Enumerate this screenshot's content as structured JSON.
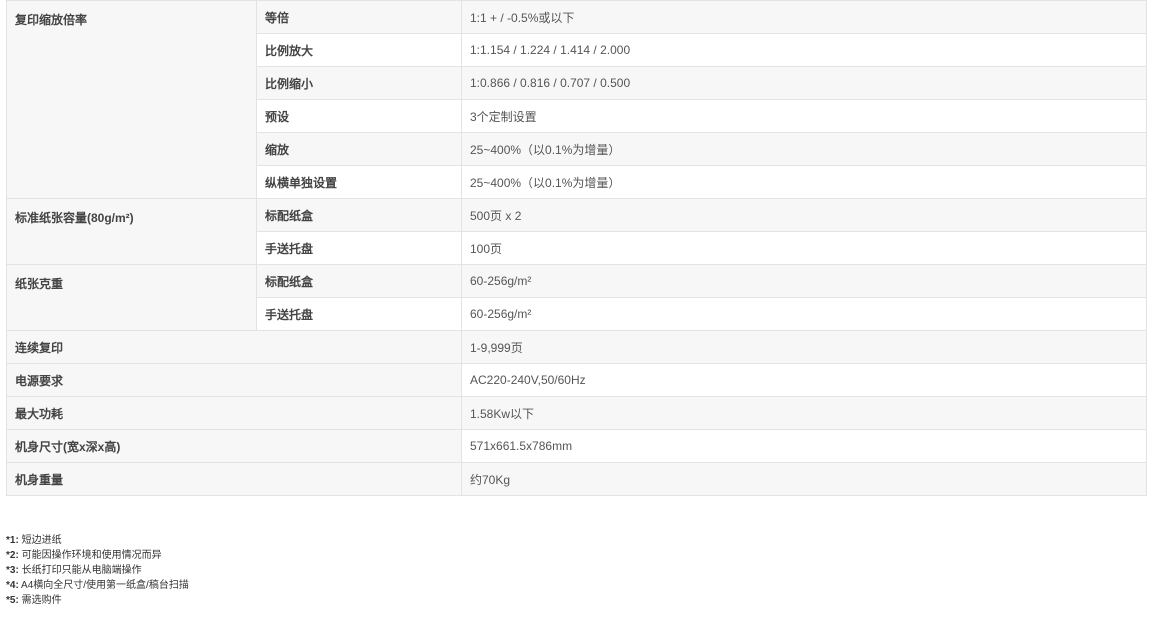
{
  "rows": [
    {
      "category": "复印缩放倍率",
      "sub": "等倍",
      "value": "1:1 + / -0.5%或以下"
    },
    {
      "sub": "比例放大",
      "value": "1:1.154 / 1.224 / 1.414 / 2.000"
    },
    {
      "sub": "比例缩小",
      "value": "1:0.866 / 0.816 / 0.707 / 0.500"
    },
    {
      "sub": "预设",
      "value": "3个定制设置"
    },
    {
      "sub": "缩放",
      "value": "25~400%（以0.1%为增量）"
    },
    {
      "sub": "纵横单独设置",
      "value": "25~400%（以0.1%为增量）"
    },
    {
      "category": "标准纸张容量(80g/m²)",
      "sub": "标配纸盒",
      "value": "500页 x 2"
    },
    {
      "sub": "手送托盘",
      "value": "100页"
    },
    {
      "category": "纸张克重",
      "sub": "标配纸盒",
      "value": "60-256g/m²"
    },
    {
      "sub": "手送托盘",
      "value": "60-256g/m²"
    },
    {
      "category": "连续复印",
      "value": "1-9,999页"
    },
    {
      "category": "电源要求",
      "value": "AC220-240V,50/60Hz"
    },
    {
      "category": "最大功耗",
      "value": "1.58Kw以下"
    },
    {
      "category": "机身尺寸(宽x深x高)",
      "value": "571x661.5x786mm"
    },
    {
      "category": "机身重量",
      "value": "约70Kg"
    }
  ],
  "notes": [
    {
      "mark": "*1:",
      "text": "短边进纸"
    },
    {
      "mark": "*2:",
      "text": "可能因操作环境和使用情况而异"
    },
    {
      "mark": "*3:",
      "text": "长纸打印只能从电脑端操作"
    },
    {
      "mark": "*4:",
      "text": "A4横向全尺寸/使用第一纸盒/稿台扫描"
    },
    {
      "mark": "*5:",
      "text": "需选购件"
    }
  ]
}
